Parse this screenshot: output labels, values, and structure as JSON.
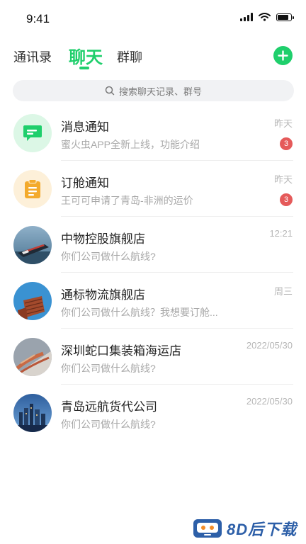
{
  "status": {
    "time": "9:41"
  },
  "tabs": [
    {
      "label": "通讯录",
      "active": false
    },
    {
      "label": "聊天",
      "active": true
    },
    {
      "label": "群聊",
      "active": false
    }
  ],
  "accent_color": "#1fcf6c",
  "search": {
    "placeholder": "搜索聊天记录、群号"
  },
  "chats": [
    {
      "name": "消息通知",
      "preview": "蜜火虫APP全新上线，功能介绍",
      "time": "昨天",
      "badge": "3",
      "icon": "message-icon"
    },
    {
      "name": "订舱通知",
      "preview": "王可可申请了青岛-非洲的运价",
      "time": "昨天",
      "badge": "3",
      "icon": "clipboard-icon"
    },
    {
      "name": "中物控股旗舰店",
      "preview": "你们公司做什么航线?",
      "time": "12:21",
      "badge": null,
      "icon": "ship-photo"
    },
    {
      "name": "通标物流旗舰店",
      "preview": "你们公司做什么航线？我想要订舱...",
      "time": "周三",
      "badge": null,
      "icon": "container-photo"
    },
    {
      "name": "深圳蛇口集装箱海运店",
      "preview": "你们公司做什么航线?",
      "time": "2022/05/30",
      "badge": null,
      "icon": "port-photo"
    },
    {
      "name": "青岛远航货代公司",
      "preview": "你们公司做什么航线?",
      "time": "2022/05/30",
      "badge": null,
      "icon": "city-photo"
    }
  ],
  "watermark": {
    "text": "8D后下载"
  }
}
